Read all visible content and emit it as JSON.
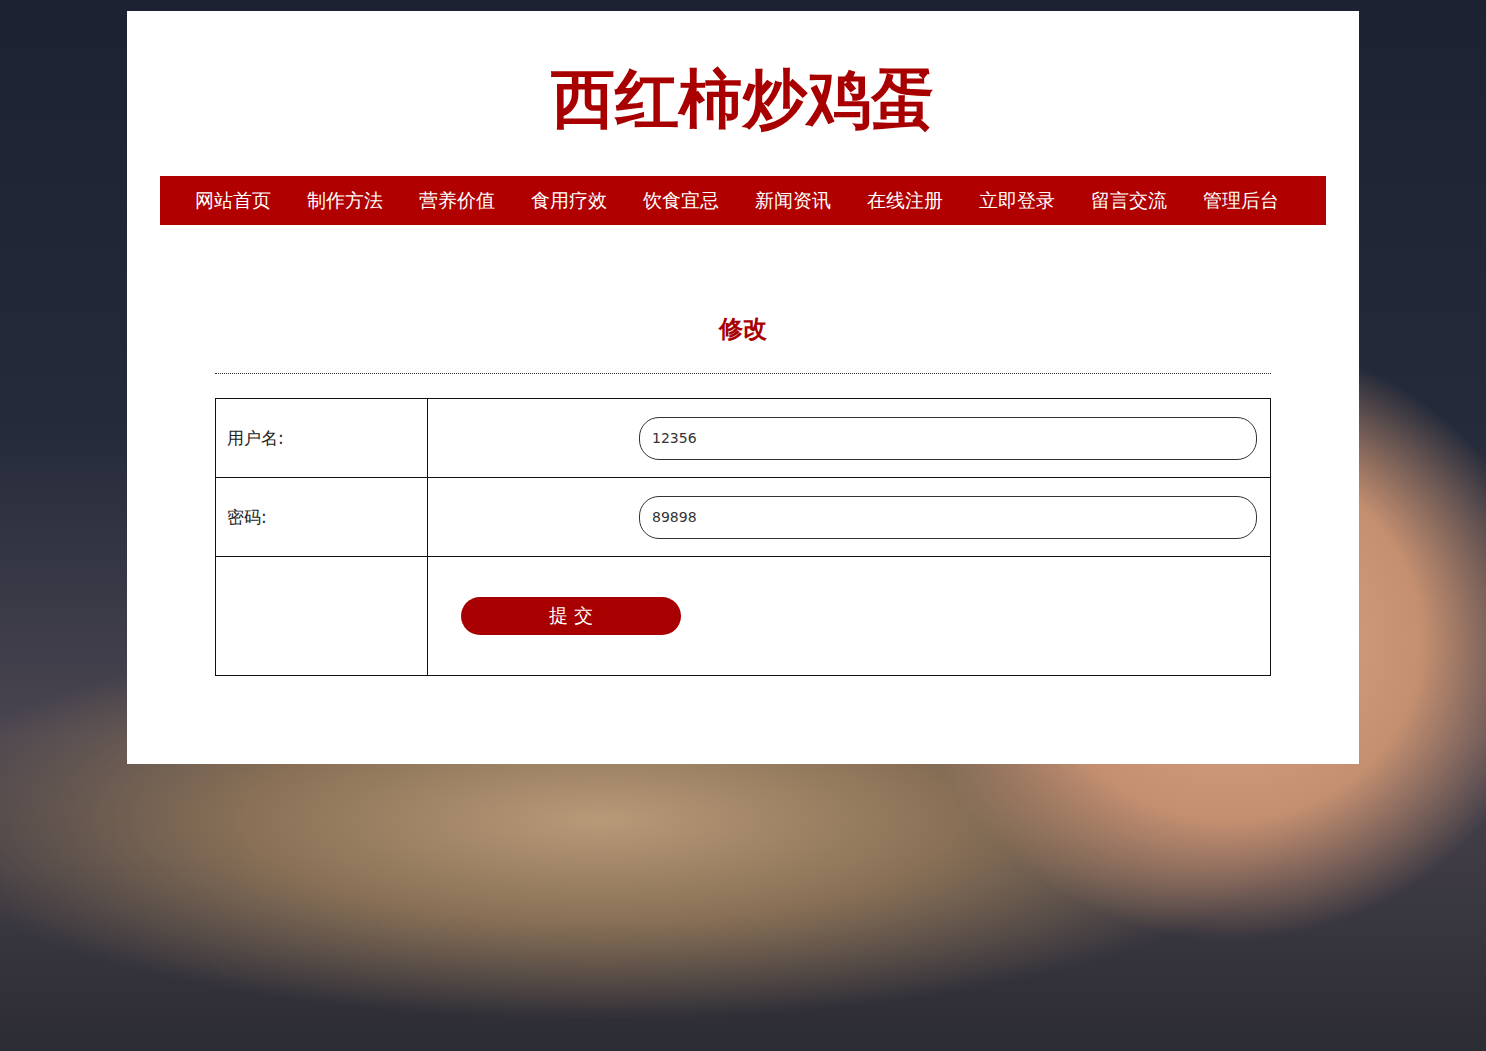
{
  "site": {
    "title": "西红柿炒鸡蛋"
  },
  "nav": {
    "items": [
      "网站首页",
      "制作方法",
      "营养价值",
      "食用疗效",
      "饮食宜忌",
      "新闻资讯",
      "在线注册",
      "立即登录",
      "留言交流",
      "管理后台"
    ]
  },
  "form": {
    "heading": "修改",
    "fields": [
      {
        "label": "用户名:",
        "value": "12356"
      },
      {
        "label": "密码:",
        "value": "89898"
      }
    ],
    "submit": "提 交"
  }
}
